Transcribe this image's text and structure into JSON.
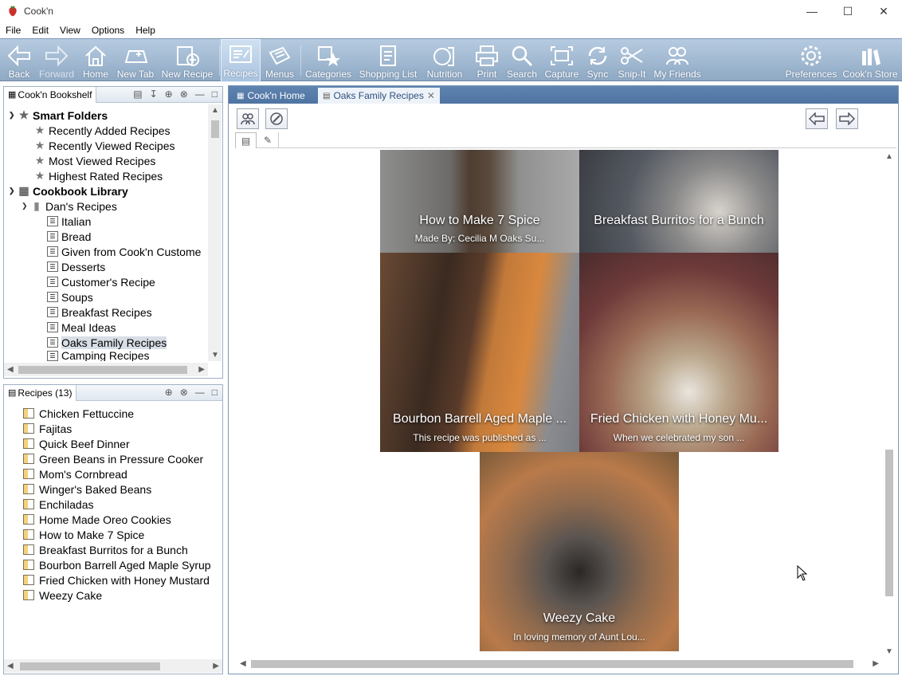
{
  "window": {
    "title": "Cook'n"
  },
  "menu": [
    "File",
    "Edit",
    "View",
    "Options",
    "Help"
  ],
  "toolbar": {
    "back": "Back",
    "forward": "Forward",
    "home": "Home",
    "new_tab": "New Tab",
    "new_recipe": "New Recipe",
    "recipes": "Recipes",
    "menus": "Menus",
    "categories": "Categories",
    "shopping_list": "Shopping List",
    "nutrition": "Nutrition",
    "print": "Print",
    "search": "Search",
    "capture": "Capture",
    "sync": "Sync",
    "snip_it": "Snip-It",
    "my_friends": "My Friends",
    "preferences": "Preferences",
    "store": "Cook'n Store"
  },
  "bookshelf": {
    "tab": "Cook'n Bookshelf",
    "smart_folders": "Smart Folders",
    "smart_items": [
      "Recently Added Recipes",
      "Recently Viewed Recipes",
      "Most Viewed Recipes",
      "Highest Rated Recipes"
    ],
    "library": "Cookbook Library",
    "cookbook": "Dan's Recipes",
    "chapters": [
      "Italian",
      "Bread",
      "Given from Cook'n Custome",
      "Desserts",
      "Customer's Recipe",
      "Soups",
      "Breakfast Recipes",
      "Meal Ideas",
      "Oaks Family Recipes",
      "Camping Recipes"
    ]
  },
  "recipes_panel": {
    "tab": "Recipes (13)",
    "items": [
      "Chicken Fettuccine",
      "Fajitas",
      "Quick Beef Dinner",
      "Green Beans in Pressure Cooker",
      "Mom's Cornbread",
      "Winger's Baked Beans",
      "Enchiladas",
      "Home Made Oreo Cookies",
      "How to Make 7 Spice",
      "Breakfast Burritos for a Bunch",
      "Bourbon Barrell Aged Maple Syrup",
      "Fried Chicken with Honey Mustard",
      "Weezy Cake"
    ]
  },
  "main": {
    "tabs": [
      "Cook'n Home",
      "Oaks Family Recipes"
    ],
    "cards": [
      {
        "title": "How to Make 7 Spice",
        "subtitle": "Made By: Cecilia M Oaks Su..."
      },
      {
        "title": "Breakfast Burritos for a Bunch",
        "subtitle": ""
      },
      {
        "title": "Bourbon Barrell Aged Maple ...",
        "subtitle": "This recipe was published as ..."
      },
      {
        "title": "Fried Chicken with Honey Mu...",
        "subtitle": "When we celebrated my son ..."
      },
      {
        "title": "Weezy Cake",
        "subtitle": "In loving memory of Aunt Lou..."
      }
    ]
  },
  "colors": {
    "toolbar": "#9fb6cf",
    "tabstrip": "#5a7fab",
    "selection": "#d7dee6"
  }
}
